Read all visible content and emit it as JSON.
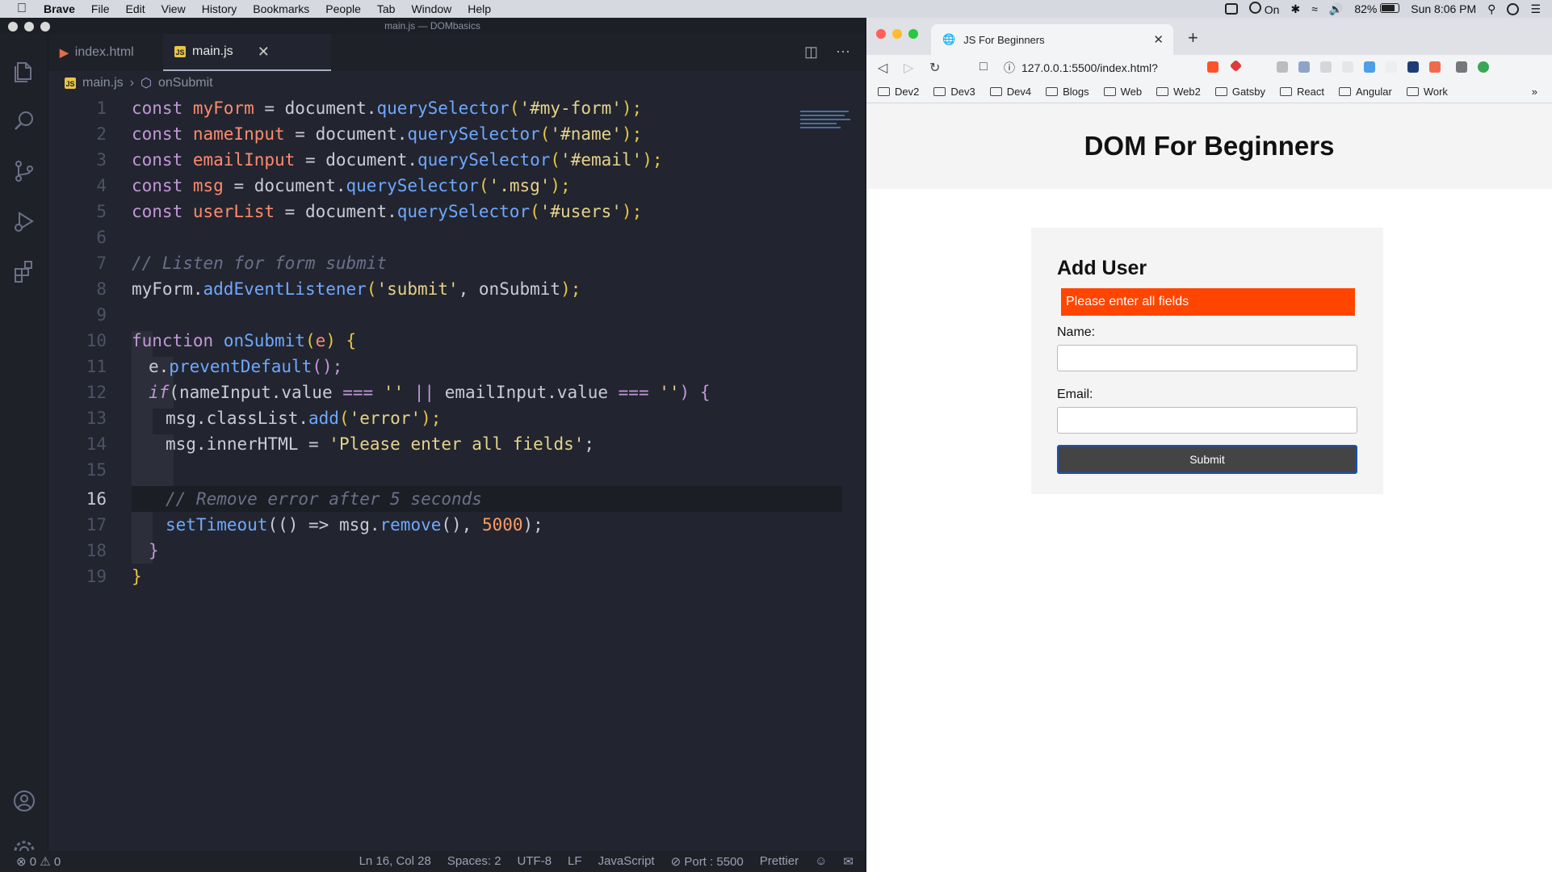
{
  "menubar": {
    "app": "Brave",
    "items": [
      "File",
      "Edit",
      "View",
      "History",
      "Bookmarks",
      "People",
      "Tab",
      "Window",
      "Help"
    ],
    "status_on": "On",
    "battery": "82%",
    "clock": "Sun 8:06 PM"
  },
  "vscode": {
    "window_title": "main.js — DOMbasics",
    "tabs": [
      {
        "label": "index.html",
        "active": false
      },
      {
        "label": "main.js",
        "active": true
      }
    ],
    "breadcrumb": {
      "file": "main.js",
      "symbol": "onSubmit"
    },
    "status": {
      "errors": "0",
      "warnings": "0",
      "position": "Ln 16, Col 28",
      "spaces": "Spaces: 2",
      "encoding": "UTF-8",
      "eol": "LF",
      "language": "JavaScript",
      "port": "Port : 5500",
      "formatter": "Prettier"
    },
    "line_numbers": [
      "1",
      "2",
      "3",
      "4",
      "5",
      "6",
      "7",
      "8",
      "9",
      "10",
      "11",
      "12",
      "13",
      "14",
      "15",
      "16",
      "17",
      "18",
      "19"
    ],
    "code": {
      "l1": [
        "const ",
        "myForm",
        " = document.",
        "querySelector",
        "(",
        "'#my-form'",
        ");"
      ],
      "l2": [
        "const ",
        "nameInput",
        " = document.",
        "querySelector",
        "(",
        "'#name'",
        ");"
      ],
      "l3": [
        "const ",
        "emailInput",
        " = document.",
        "querySelector",
        "(",
        "'#email'",
        ");"
      ],
      "l4": [
        "const ",
        "msg",
        " = document.",
        "querySelector",
        "(",
        "'.msg'",
        ");"
      ],
      "l5": [
        "const ",
        "userList",
        " = document.",
        "querySelector",
        "(",
        "'#users'",
        ");"
      ],
      "l7": "// Listen for form submit",
      "l8": [
        "myForm.",
        "addEventListener",
        "(",
        "'submit'",
        ", onSubmit",
        ");"
      ],
      "l10": [
        "function ",
        "onSubmit",
        "(",
        "e",
        ") {"
      ],
      "l11": [
        "e.",
        "preventDefault",
        "();"
      ],
      "l12": [
        "if",
        "(nameInput.value ",
        "===",
        " ",
        "''",
        " ",
        "||",
        " emailInput.value ",
        "===",
        " ",
        "''",
        ") {"
      ],
      "l13": [
        "msg.classList.",
        "add",
        "(",
        "'error'",
        ");"
      ],
      "l14": [
        "msg.innerHTML = ",
        "'Please enter all fields'",
        ";"
      ],
      "l16": "// Remove error after 5 seconds",
      "l17": [
        "setTimeout",
        "(() => msg.",
        "remove",
        "(), ",
        "5000",
        ");"
      ],
      "l18": "}",
      "l19": "}"
    }
  },
  "browser": {
    "tab_title": "JS For Beginners",
    "url": "127.0.0.1:5500/index.html?",
    "bookmarks": [
      "Dev2",
      "Dev3",
      "Dev4",
      "Blogs",
      "Web",
      "Web2",
      "Gatsby",
      "React",
      "Angular",
      "Work"
    ],
    "page": {
      "heading": "DOM For Beginners",
      "form_title": "Add User",
      "error_msg": "Please enter all fields",
      "name_label": "Name:",
      "email_label": "Email:",
      "submit_label": "Submit",
      "name_value": "",
      "email_value": ""
    }
  }
}
